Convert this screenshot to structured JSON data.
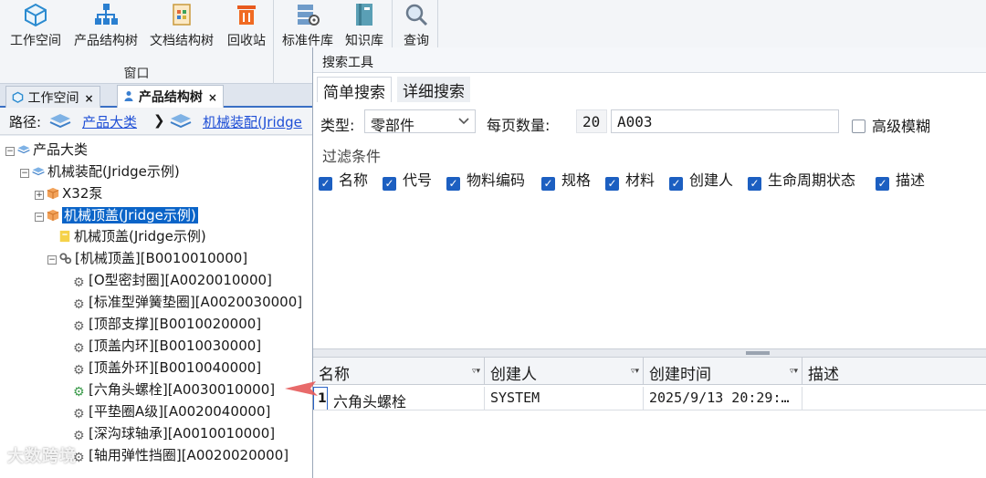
{
  "ribbon": {
    "window_group_label": "窗口",
    "buttons": [
      {
        "label": "工作空间",
        "icon": "cube-icon"
      },
      {
        "label": "产品结构树",
        "icon": "org-tree-icon"
      },
      {
        "label": "文档结构树",
        "icon": "document-tree-icon"
      },
      {
        "label": "回收站",
        "icon": "trash-icon"
      },
      {
        "label": "标准件库",
        "icon": "server-library-icon"
      },
      {
        "label": "知识库",
        "icon": "book-icon"
      },
      {
        "label": "查询",
        "icon": "magnifier-icon"
      }
    ]
  },
  "tabs": [
    {
      "label": "工作空间",
      "close": "×"
    },
    {
      "label": "产品结构树",
      "close": "×"
    }
  ],
  "path": {
    "label": "路径:",
    "crumb1": "产品大类",
    "sep": "❯",
    "crumb2": "机械装配(Jridge"
  },
  "tree": {
    "root": "产品大类",
    "assembly": "机械装配(Jridge示例)",
    "pump": "X32泵",
    "top_cover": "机械顶盖(Jridge示例)",
    "doc": "机械顶盖(Jridge示例)",
    "bom": "[机械顶盖][B0010010000]",
    "parts": [
      "[O型密封圈][A0020010000]",
      "[标准型弹簧垫圈][A0020030000]",
      "[顶部支撑][B0010020000]",
      "[顶盖内环][B0010030000]",
      "[顶盖外环][B0010040000]",
      "[六角头螺栓][A0030010000]",
      "[平垫圈A级][A0020040000]",
      "[深沟球轴承][A0010010000]",
      "[轴用弹性挡圈][A0020020000]"
    ]
  },
  "search": {
    "title": "搜索工具",
    "tab_simple": "简单搜索",
    "tab_detail": "详细搜索",
    "type_label": "类型:",
    "type_value": "零部件",
    "page_label": "每页数量:",
    "page_value": "20",
    "query_value": "A003",
    "fuzzy_label": "高级模糊",
    "filter_title": "过滤条件",
    "filters": [
      "名称",
      "代号",
      "物料编码",
      "规格",
      "材料",
      "创建人",
      "生命周期状态",
      "描述"
    ],
    "columns": [
      "名称",
      "创建人",
      "创建时间",
      "描述"
    ],
    "filter_glyph": "▿▾",
    "rows": [
      {
        "num": "1",
        "name": "六角头螺栓",
        "creator": "SYSTEM",
        "time": "2025/9/13 20:29:…",
        "desc": ""
      }
    ]
  },
  "watermark": "大数跨境",
  "colors": {
    "accent": "#1c5fc1",
    "selection": "#0a64c8",
    "link": "#1f4fd6",
    "arrow": "#e65a5a"
  }
}
